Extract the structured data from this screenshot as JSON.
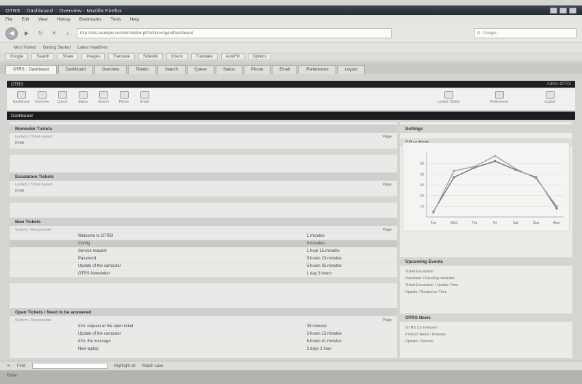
{
  "window": {
    "title": "OTRS :: Dashboard :: Overview - Mozilla Firefox"
  },
  "menu": [
    "File",
    "Edit",
    "View",
    "History",
    "Bookmarks",
    "Tools",
    "Help"
  ],
  "nav": {
    "url": "http://otrs.example.com/otrs/index.pl?Action=AgentDashboard",
    "search_placeholder": "Google"
  },
  "bookmarks": [
    "Most Visited",
    "Getting Started",
    "Latest Headlines"
  ],
  "toolbar2": [
    "Google",
    "Search",
    "Share",
    "Images",
    "Translate",
    "Sidewiki",
    "Check",
    "Translate",
    "AutoFill",
    "Options"
  ],
  "tabs": [
    {
      "label": "OTRS :: Dashboard",
      "active": true
    },
    {
      "label": "Dashboard",
      "active": false
    },
    {
      "label": "Overview",
      "active": false
    },
    {
      "label": "Tickets",
      "active": false
    },
    {
      "label": "Search",
      "active": false
    },
    {
      "label": "Queue",
      "active": false
    },
    {
      "label": "Status",
      "active": false
    },
    {
      "label": "Phone",
      "active": false
    },
    {
      "label": "Email",
      "active": false
    },
    {
      "label": "Preferences",
      "active": false
    },
    {
      "label": "Logout",
      "active": false
    }
  ],
  "app": {
    "name": "OTRS",
    "user": "Admin OTRS",
    "tools": [
      "Dashboard",
      "Overview",
      "Queue",
      "Status",
      "Search",
      "Phone",
      "Email"
    ],
    "right_tools": [
      "Locked Tickets",
      "Preferences",
      "Logout"
    ],
    "section": "Dashboard"
  },
  "reminder": {
    "title": "Reminder Tickets",
    "sub": "Locked / Ticket owned",
    "more": "Page",
    "none": "none"
  },
  "escalation": {
    "title": "Escalation Tickets",
    "sub": "Locked / Ticket owned",
    "more": "Page",
    "none": "none"
  },
  "new_tickets": {
    "title": "New Tickets",
    "sub": "System / Responsible",
    "more": "Page",
    "rows": [
      {
        "id": "",
        "subject": "Welcome to OTRS!",
        "age": "1 minutes",
        "highlight": false
      },
      {
        "id": "",
        "subject": "Config",
        "age": "5 minutes",
        "highlight": true
      },
      {
        "id": "",
        "subject": "Service request",
        "age": "1 hour 15 minutes",
        "highlight": false
      },
      {
        "id": "",
        "subject": "Password",
        "age": "5 hours 23 minutes",
        "highlight": false
      },
      {
        "id": "",
        "subject": "Update of the computer",
        "age": "5 hours 35 minutes",
        "highlight": false
      },
      {
        "id": "",
        "subject": "OTRS Newsletter",
        "age": "1 day 3 hours",
        "highlight": false
      }
    ]
  },
  "open_tickets": {
    "title": "Open Tickets / Need to be answered",
    "sub": "System / Responsible",
    "more": "Page",
    "rows": [
      {
        "id": "",
        "subject": "Info: request at the open ticket",
        "age": "33 minutes",
        "highlight": false
      },
      {
        "id": "",
        "subject": "Update of the computer",
        "age": "2 hours 15 minutes",
        "highlight": false
      },
      {
        "id": "",
        "subject": "Info: the message",
        "age": "5 hours 41 minutes",
        "highlight": false
      },
      {
        "id": "",
        "subject": "New laptop",
        "age": "2 days 1 hour",
        "highlight": false
      }
    ]
  },
  "sidebar": {
    "settings_title": "Settings",
    "stats_title": "7 Day Stats",
    "events_title": "Upcoming Events",
    "events": [
      "Ticket Escalation",
      "Reminder / Pending reminder",
      "Ticket Escalation / Update Time",
      "Update / Response Time"
    ],
    "news_title": "OTRS News",
    "news": [
      "OTRS 3.0 released",
      "Product News / Release",
      "Update / Service"
    ]
  },
  "chart_data": {
    "type": "line",
    "categories": [
      "Tue",
      "Wed",
      "Thu",
      "Fri",
      "Sat",
      "Sun",
      "Mon"
    ],
    "yticks": [
      10,
      20,
      30,
      40,
      50
    ],
    "ylim": [
      0,
      60
    ],
    "series": [
      {
        "name": "",
        "values": [
          5,
          37,
          46,
          52,
          44,
          37,
          8
        ],
        "color": "#6f7276"
      },
      {
        "name": "",
        "values": [
          4,
          43,
          47,
          57,
          45,
          36,
          10
        ],
        "color": "#9fa2a6"
      }
    ]
  },
  "status": {
    "done": "Done",
    "find_label": "Find",
    "highlight": "Highlight all",
    "match_case": "Match case"
  }
}
